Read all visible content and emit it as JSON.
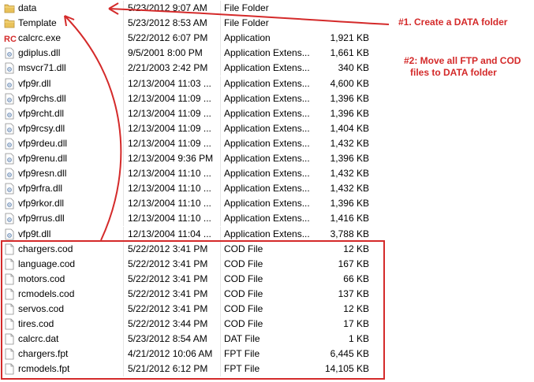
{
  "files": [
    {
      "name": "data",
      "date": "5/23/2012 9:07 AM",
      "type": "File Folder",
      "size": "",
      "icon": "folder-icon"
    },
    {
      "name": "Template",
      "date": "5/23/2012 8:53 AM",
      "type": "File Folder",
      "size": "",
      "icon": "folder-icon"
    },
    {
      "name": "calcrc.exe",
      "date": "5/22/2012 6:07 PM",
      "type": "Application",
      "size": "1,921 KB",
      "icon": "rc-app-icon"
    },
    {
      "name": "gdiplus.dll",
      "date": "9/5/2001 8:00 PM",
      "type": "Application Extens...",
      "size": "1,661 KB",
      "icon": "dll-icon"
    },
    {
      "name": "msvcr71.dll",
      "date": "2/21/2003 2:42 PM",
      "type": "Application Extens...",
      "size": "340 KB",
      "icon": "dll-icon"
    },
    {
      "name": "vfp9r.dll",
      "date": "12/13/2004 11:03 ...",
      "type": "Application Extens...",
      "size": "4,600 KB",
      "icon": "dll-icon"
    },
    {
      "name": "vfp9rchs.dll",
      "date": "12/13/2004 11:09 ...",
      "type": "Application Extens...",
      "size": "1,396 KB",
      "icon": "dll-icon"
    },
    {
      "name": "vfp9rcht.dll",
      "date": "12/13/2004 11:09 ...",
      "type": "Application Extens...",
      "size": "1,396 KB",
      "icon": "dll-icon"
    },
    {
      "name": "vfp9rcsy.dll",
      "date": "12/13/2004 11:09 ...",
      "type": "Application Extens...",
      "size": "1,404 KB",
      "icon": "dll-icon"
    },
    {
      "name": "vfp9rdeu.dll",
      "date": "12/13/2004 11:09 ...",
      "type": "Application Extens...",
      "size": "1,432 KB",
      "icon": "dll-icon"
    },
    {
      "name": "vfp9renu.dll",
      "date": "12/13/2004 9:36 PM",
      "type": "Application Extens...",
      "size": "1,396 KB",
      "icon": "dll-icon"
    },
    {
      "name": "vfp9resn.dll",
      "date": "12/13/2004 11:10 ...",
      "type": "Application Extens...",
      "size": "1,432 KB",
      "icon": "dll-icon"
    },
    {
      "name": "vfp9rfra.dll",
      "date": "12/13/2004 11:10 ...",
      "type": "Application Extens...",
      "size": "1,432 KB",
      "icon": "dll-icon"
    },
    {
      "name": "vfp9rkor.dll",
      "date": "12/13/2004 11:10 ...",
      "type": "Application Extens...",
      "size": "1,396 KB",
      "icon": "dll-icon"
    },
    {
      "name": "vfp9rrus.dll",
      "date": "12/13/2004 11:10 ...",
      "type": "Application Extens...",
      "size": "1,416 KB",
      "icon": "dll-icon"
    },
    {
      "name": "vfp9t.dll",
      "date": "12/13/2004 11:04 ...",
      "type": "Application Extens...",
      "size": "3,788 KB",
      "icon": "dll-icon"
    },
    {
      "name": "chargers.cod",
      "date": "5/22/2012 3:41 PM",
      "type": "COD File",
      "size": "12 KB",
      "icon": "file-icon"
    },
    {
      "name": "language.cod",
      "date": "5/22/2012 3:41 PM",
      "type": "COD File",
      "size": "167 KB",
      "icon": "file-icon"
    },
    {
      "name": "motors.cod",
      "date": "5/22/2012 3:41 PM",
      "type": "COD File",
      "size": "66 KB",
      "icon": "file-icon"
    },
    {
      "name": "rcmodels.cod",
      "date": "5/22/2012 3:41 PM",
      "type": "COD File",
      "size": "137 KB",
      "icon": "file-icon"
    },
    {
      "name": "servos.cod",
      "date": "5/22/2012 3:41 PM",
      "type": "COD File",
      "size": "12 KB",
      "icon": "file-icon"
    },
    {
      "name": "tires.cod",
      "date": "5/22/2012 3:44 PM",
      "type": "COD File",
      "size": "17 KB",
      "icon": "file-icon"
    },
    {
      "name": "calcrc.dat",
      "date": "5/23/2012 8:54 AM",
      "type": "DAT File",
      "size": "1 KB",
      "icon": "file-icon"
    },
    {
      "name": "chargers.fpt",
      "date": "4/21/2012 10:06 AM",
      "type": "FPT File",
      "size": "6,445 KB",
      "icon": "file-icon"
    },
    {
      "name": "rcmodels.fpt",
      "date": "5/21/2012 6:12 PM",
      "type": "FPT File",
      "size": "14,105 KB",
      "icon": "file-icon"
    }
  ],
  "annotations": {
    "step1": "#1. Create a DATA folder",
    "step2_line1": "#2: Move all FTP and COD",
    "step2_line2": "files to DATA folder"
  },
  "colors": {
    "annotation_red": "#d42a2a",
    "folder_yellow": "#e9c25a"
  }
}
